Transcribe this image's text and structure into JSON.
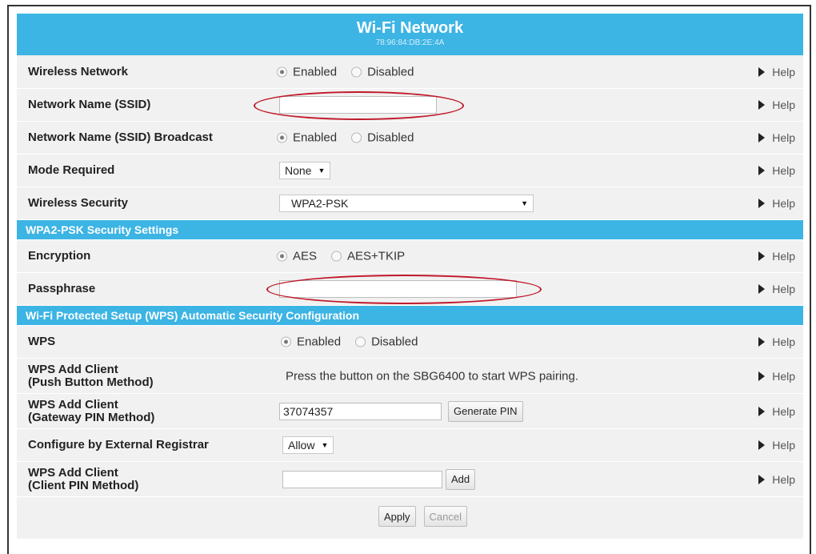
{
  "title": "Wi-Fi Network",
  "mac": "78:96:84:DB:2E:4A",
  "help_label": "Help",
  "radio": {
    "enabled": "Enabled",
    "disabled": "Disabled"
  },
  "rows": {
    "wireless_network": {
      "label": "Wireless Network",
      "value": "Enabled"
    },
    "ssid": {
      "label": "Network Name (SSID)",
      "value": ""
    },
    "ssid_broadcast": {
      "label": "Network Name (SSID) Broadcast",
      "value": "Enabled"
    },
    "mode_required": {
      "label": "Mode Required",
      "value": "None"
    },
    "wireless_security": {
      "label": "Wireless Security",
      "value": "WPA2-PSK"
    },
    "encryption": {
      "label": "Encryption",
      "options": [
        "AES",
        "AES+TKIP"
      ],
      "value": "AES"
    },
    "passphrase": {
      "label": "Passphrase",
      "value": ""
    },
    "wps": {
      "label": "WPS",
      "value": "Enabled"
    },
    "wps_push": {
      "label_1": "WPS Add Client",
      "label_2": "(Push Button Method)",
      "text": "Press the button on the SBG6400 to start WPS pairing."
    },
    "wps_gateway": {
      "label_1": "WPS Add Client",
      "label_2": "(Gateway PIN Method)",
      "value": "37074357",
      "button": "Generate PIN"
    },
    "external_registrar": {
      "label": "Configure by External Registrar",
      "value": "Allow"
    },
    "wps_client": {
      "label_1": "WPS Add Client",
      "label_2": "(Client PIN Method)",
      "value": "",
      "button": "Add"
    }
  },
  "sections": {
    "wpa2": "WPA2-PSK Security Settings",
    "wps": "Wi-Fi Protected Setup (WPS) Automatic Security Configuration"
  },
  "footer": {
    "apply": "Apply",
    "cancel": "Cancel"
  },
  "colors": {
    "header": "#3cb4e4",
    "row_bg": "#f1f1f1",
    "highlight_ellipse": "#c0192a"
  }
}
